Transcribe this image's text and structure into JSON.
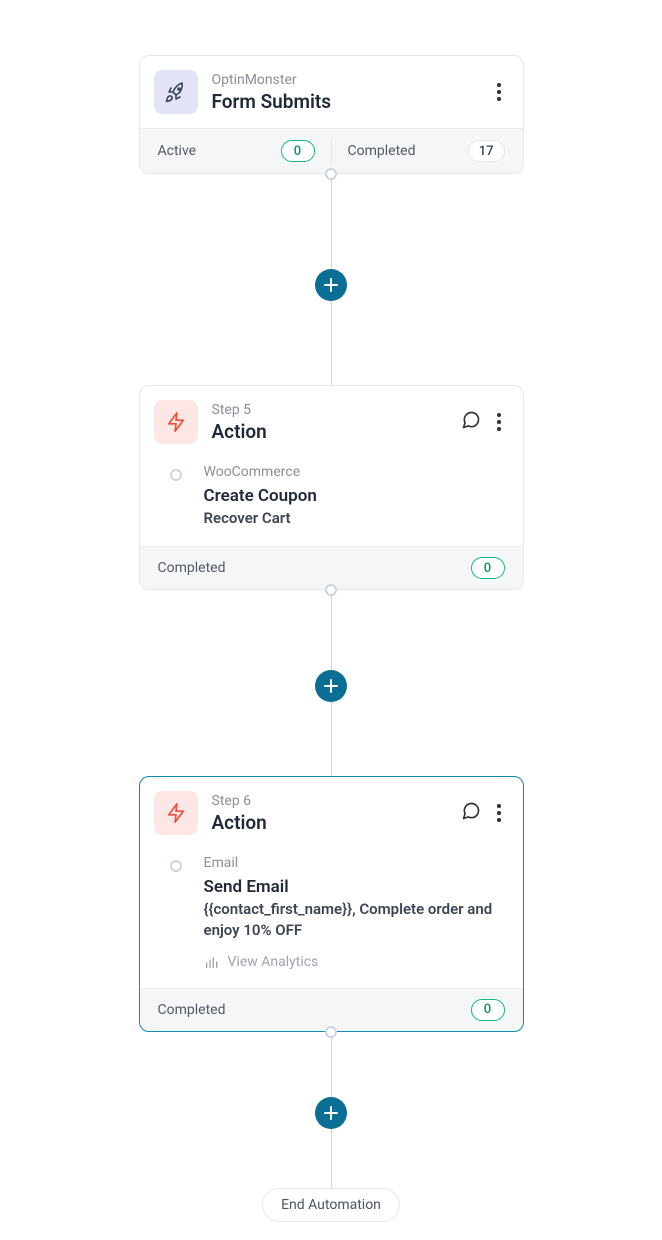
{
  "trigger": {
    "integration": "OptinMonster",
    "title": "Form Submits",
    "stats": {
      "active_label": "Active",
      "active_count": "0",
      "completed_label": "Completed",
      "completed_count": "17"
    }
  },
  "step5": {
    "step_label": "Step 5",
    "title": "Action",
    "integration": "WooCommerce",
    "action_name": "Create Coupon",
    "description": "Recover Cart",
    "completed_label": "Completed",
    "completed_count": "0"
  },
  "step6": {
    "step_label": "Step 6",
    "title": "Action",
    "integration": "Email",
    "action_name": "Send Email",
    "description": "{{contact_first_name}}, Complete order and enjoy 10% OFF",
    "analytics_label": "View Analytics",
    "completed_label": "Completed",
    "completed_count": "0"
  },
  "end_label": "End Automation"
}
